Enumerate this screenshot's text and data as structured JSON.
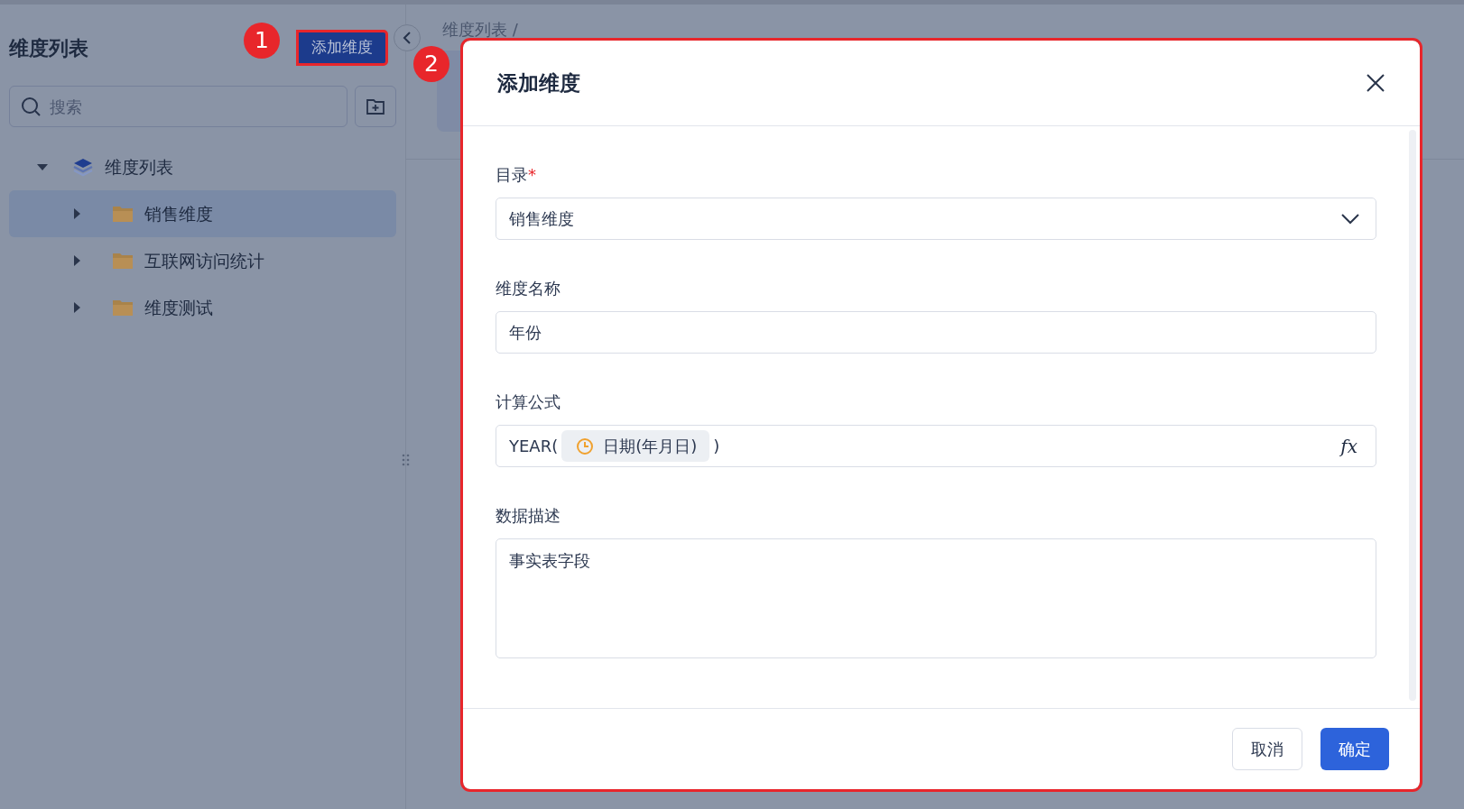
{
  "sidebar": {
    "title": "维度列表",
    "add_button": "添加维度",
    "search": {
      "placeholder": "搜索"
    },
    "tree": [
      {
        "label": "维度列表",
        "selected": false,
        "expanded": true,
        "children": [
          {
            "label": "销售维度",
            "selected": true,
            "expanded": false
          },
          {
            "label": "互联网访问统计",
            "selected": false,
            "expanded": false
          },
          {
            "label": "维度测试",
            "selected": false,
            "expanded": false
          }
        ]
      }
    ]
  },
  "breadcrumb": "维度列表 /",
  "dialog": {
    "title": "添加维度",
    "fields": [
      {
        "kind": "select",
        "label": "目录",
        "required_mark": "*",
        "value": "销售维度"
      },
      {
        "kind": "text",
        "label": "维度名称",
        "value": "年份"
      },
      {
        "kind": "formula",
        "label": "计算公式",
        "prefix": "YEAR(",
        "token": "日期(年月日)",
        "suffix": ")",
        "function_button": "fx"
      },
      {
        "kind": "textarea",
        "label": "数据描述",
        "value": "事实表字段"
      }
    ],
    "buttons": [
      {
        "label": "取消",
        "primary": false
      },
      {
        "label": "确定",
        "primary": true
      }
    ]
  },
  "annotations": [
    "1",
    "2"
  ]
}
